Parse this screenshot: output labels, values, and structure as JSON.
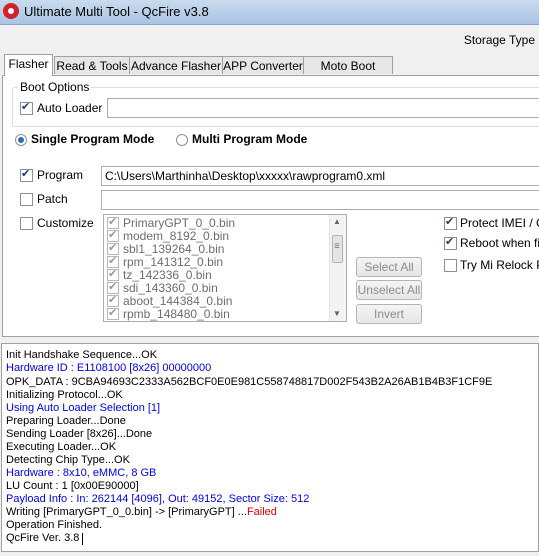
{
  "window": {
    "title": "Ultimate Multi Tool - QcFire v3.8",
    "storage_type_label": "Storage Type"
  },
  "tabs": [
    "Flasher",
    "Read & Tools",
    "Advance Flasher",
    "APP Converter",
    "Moto Boot Repair"
  ],
  "boot_options": {
    "legend": "Boot Options",
    "auto_loader_label": "Auto Loader",
    "auto_loader_checked": true,
    "auto_loader_value": ""
  },
  "modes": {
    "single": "Single Program Mode",
    "multi": "Multi Program Mode",
    "selected": "single"
  },
  "program": {
    "label": "Program",
    "checked": true,
    "value": "C:\\Users\\Marthinha\\Desktop\\xxxxx\\rawprogram0.xml"
  },
  "patch": {
    "label": "Patch",
    "checked": false,
    "value": ""
  },
  "customize": {
    "label": "Customize",
    "checked": false
  },
  "partitions": [
    "PrimaryGPT_0_0.bin",
    "modem_8192_0.bin",
    "sbl1_139264_0.bin",
    "rpm_141312_0.bin",
    "tz_142336_0.bin",
    "sdi_143360_0.bin",
    "aboot_144384_0.bin",
    "rpmb_148480_0.bin"
  ],
  "list_buttons": {
    "select_all": "Select All",
    "unselect_all": "Unselect All",
    "invert": "Invert"
  },
  "options": [
    {
      "label": "Protect IMEI / Ca",
      "checked": true
    },
    {
      "label": "Reboot when fini",
      "checked": true
    },
    {
      "label": "Try Mi Relock Pa",
      "checked": false
    }
  ],
  "log": [
    {
      "text": "Init Handshake Sequence...OK",
      "color": "#000000"
    },
    {
      "text": "Hardware ID  : E1108100 [8x26] 00000000",
      "color": "#0000ee"
    },
    {
      "text": "OPK_DATA     : 9CBA94693C2333A562BCF0E0E981C558748817D002F543B2A26AB1B4B3F1CF9E",
      "color": "#000000"
    },
    {
      "text": "Initializing Protocol...OK",
      "color": "#000000"
    },
    {
      "text": "Using Auto Loader Selection [1]",
      "color": "#0000ee"
    },
    {
      "text": "Preparing Loader...Done",
      "color": "#000000"
    },
    {
      "text": "Sending Loader [8x26]...Done",
      "color": "#000000"
    },
    {
      "text": "Executing Loader...OK",
      "color": "#000000"
    },
    {
      "text": "Detecting Chip Type...OK",
      "color": "#000000"
    },
    {
      "text": "Hardware      : 8x10, eMMC, 8 GB",
      "color": "#0000ee"
    },
    {
      "text": "LU Count      : 1 [0x00E90000]",
      "color": "#000000"
    },
    {
      "text": "Payload Info  : In: 262144 [4096], Out: 49152, Sector Size: 512",
      "color": "#0000ee"
    },
    {
      "text": "Writing [PrimaryGPT_0_0.bin] -> [PrimaryGPT] ...",
      "color": "#000000",
      "suffix": "Failed",
      "suffix_color": "#e00000"
    },
    {
      "text": "Operation Finished.",
      "color": "#000000"
    },
    {
      "text": "QcFire Ver. 3.8",
      "color": "#000000"
    }
  ]
}
